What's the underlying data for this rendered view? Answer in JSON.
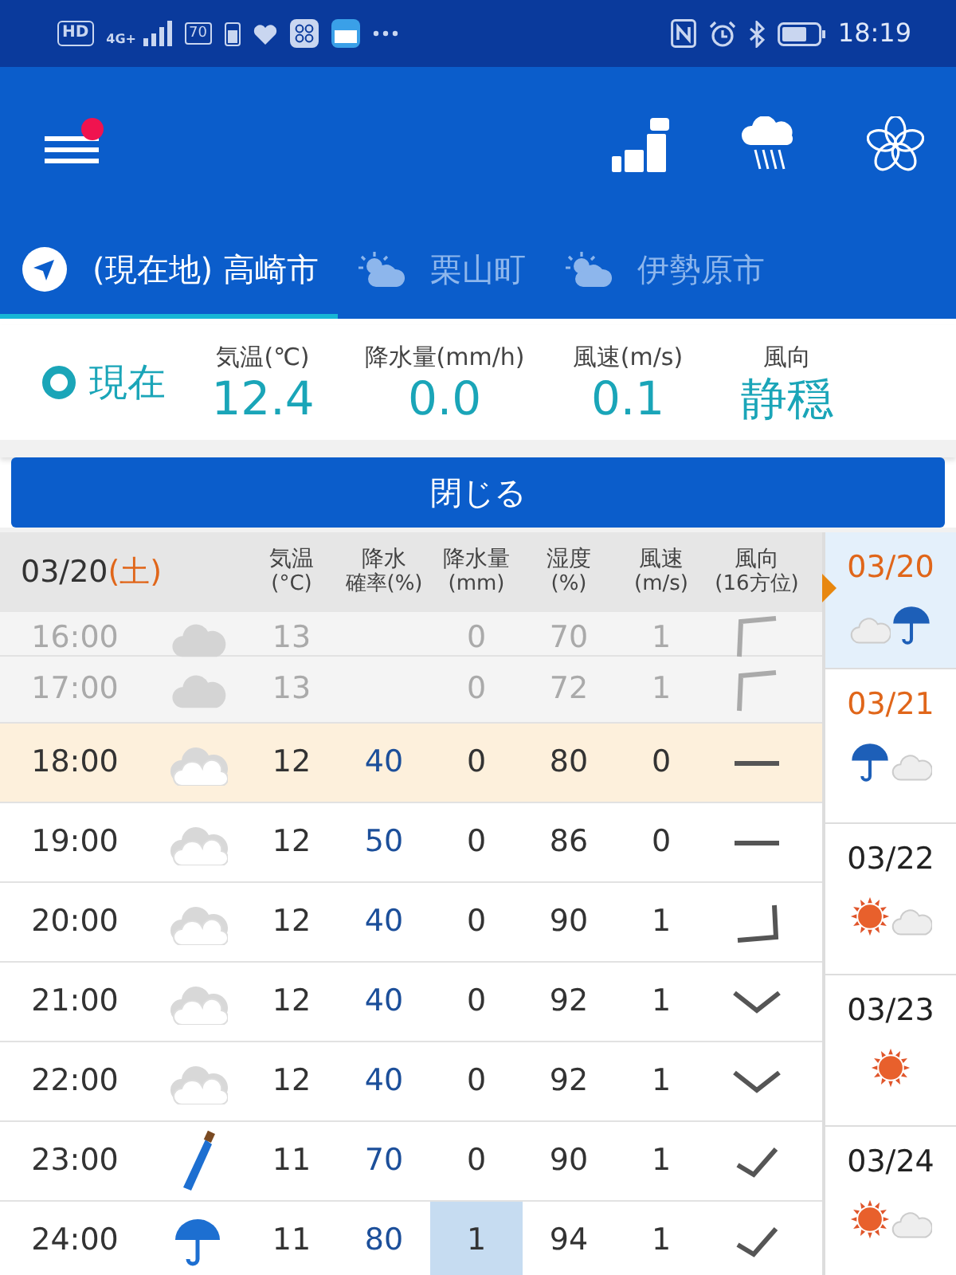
{
  "status_bar": {
    "hd": "HD",
    "network": "4G+",
    "badge": "70",
    "time": "18:19"
  },
  "app_bar": {
    "menu_notification": true
  },
  "tabs": [
    {
      "label": "(現在地) 高崎市",
      "selected": true
    },
    {
      "label": "栗山町",
      "selected": false
    },
    {
      "label": "伊勢原市",
      "selected": false
    }
  ],
  "current": {
    "label": "現在",
    "metrics": [
      {
        "label": "気温(℃)",
        "value": "12.4"
      },
      {
        "label": "降水量(mm/h)",
        "value": "0.0"
      },
      {
        "label": "風速(m/s)",
        "value": "0.1"
      },
      {
        "label": "風向",
        "value": "静穏"
      }
    ]
  },
  "close_button": "閉じる",
  "hourly": {
    "date": "03/20",
    "weekday": "(土)",
    "columns": [
      {
        "label": "気温",
        "unit": "(°C)"
      },
      {
        "label": "降水",
        "unit": "確率(%)"
      },
      {
        "label": "降水量",
        "unit": "(mm)"
      },
      {
        "label": "湿度",
        "unit": "(%)"
      },
      {
        "label": "風速",
        "unit": "(m/s)"
      },
      {
        "label": "風向",
        "unit": "(16方位)"
      }
    ],
    "rows": [
      {
        "kind": "cloudy",
        "past": true,
        "current": false,
        "time": "16:00",
        "temp": "13",
        "precip": "0",
        "humidity": "70",
        "wind": "1",
        "precip_highlight": false
      },
      {
        "kind": "cloudy",
        "past": true,
        "current": false,
        "time": "17:00",
        "temp": "13",
        "precip": "0",
        "humidity": "72",
        "wind": "1",
        "precip_highlight": false
      },
      {
        "kind": "overcast",
        "past": false,
        "current": true,
        "time": "18:00",
        "temp": "12",
        "precip_prob": "40",
        "precip": "0",
        "humidity": "80",
        "wind": "0",
        "precip_highlight": false
      },
      {
        "kind": "overcast",
        "past": false,
        "current": false,
        "time": "19:00",
        "temp": "12",
        "precip_prob": "50",
        "precip": "0",
        "humidity": "86",
        "wind": "0",
        "precip_highlight": false
      },
      {
        "kind": "overcast",
        "past": false,
        "current": false,
        "time": "20:00",
        "temp": "12",
        "precip_prob": "40",
        "precip": "0",
        "humidity": "90",
        "wind": "1",
        "precip_highlight": false
      },
      {
        "kind": "overcast",
        "past": false,
        "current": false,
        "time": "21:00",
        "temp": "12",
        "precip_prob": "40",
        "precip": "0",
        "humidity": "92",
        "wind": "1",
        "precip_highlight": false
      },
      {
        "kind": "overcast",
        "past": false,
        "current": false,
        "time": "22:00",
        "temp": "12",
        "precip_prob": "40",
        "precip": "0",
        "humidity": "92",
        "wind": "1",
        "precip_highlight": false
      },
      {
        "kind": "showers",
        "past": false,
        "current": false,
        "time": "23:00",
        "temp": "11",
        "precip_prob": "70",
        "precip": "0",
        "humidity": "90",
        "wind": "1",
        "precip_highlight": false
      },
      {
        "kind": "rain",
        "past": false,
        "current": false,
        "time": "24:00",
        "temp": "11",
        "precip_prob": "80",
        "precip": "1",
        "humidity": "94",
        "wind": "1",
        "precip_highlight": true
      }
    ]
  },
  "days": [
    {
      "kind": "cloudy-rain",
      "date": "03/20",
      "weekend": true,
      "selected": true
    },
    {
      "kind": "rain-cloudy",
      "date": "03/21",
      "weekend": true,
      "selected": false
    },
    {
      "kind": "sunny-cloudy",
      "date": "03/22",
      "weekend": false,
      "selected": false
    },
    {
      "kind": "sunny",
      "date": "03/23",
      "weekend": false,
      "selected": false
    },
    {
      "kind": "sunny-cloudy",
      "date": "03/24",
      "weekend": false,
      "selected": false
    }
  ]
}
